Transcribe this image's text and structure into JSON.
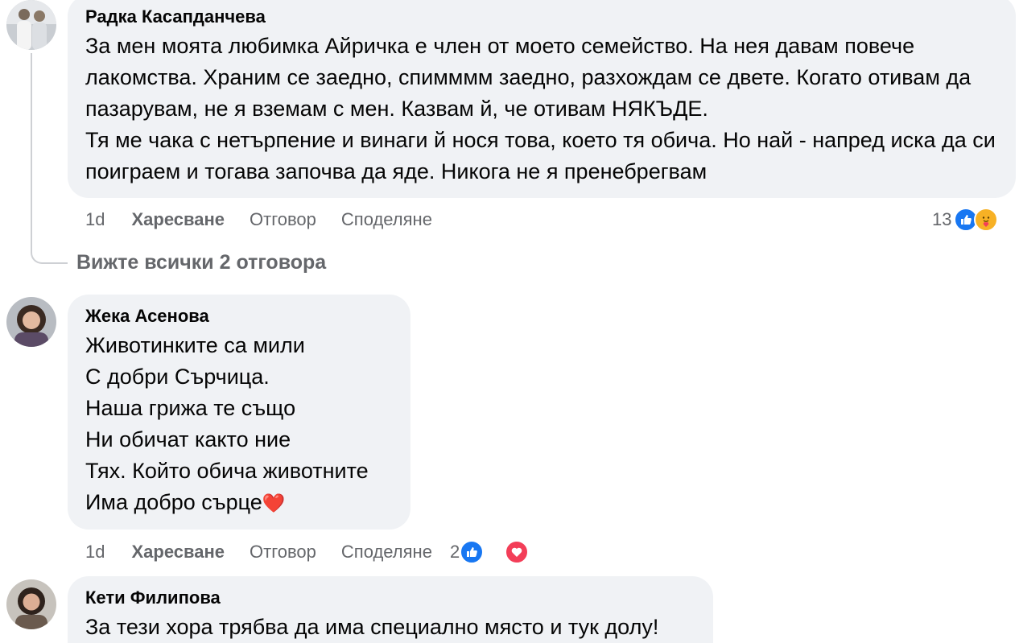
{
  "comments": [
    {
      "author": "Радка Касапданчева",
      "text": "За мен моята любимка Айричка е член от моето семейство. На нея давам повече лакомства. Храним се заедно, спимммм заедно, разхождам се двете. Когато отивам да пазарувам, не я вземам с мен. Казвам й, че отивам НЯКЪДЕ.\nТя ме чака с нетърпение и винаги й нося това, което тя обича. Но най - напред иска да си поиграем и тогава започва да яде. Никога не я пренебрегвам",
      "time": "1d",
      "like_label": "Харесване",
      "reply_label": "Отговор",
      "share_label": "Споделяне",
      "reaction_count": "13",
      "reactions": [
        "like-icon",
        "care-icon"
      ]
    },
    {
      "author": "Жека Асенова",
      "text": "Животинките са мили\nС добри Сърчица.\nНаша грижа те също\nНи обичат както ние\nТях. Който обича животните\nИма добро сърце",
      "text_emoji": "❤️",
      "time": "1d",
      "like_label": "Харесване",
      "reply_label": "Отговор",
      "share_label": "Споделяне",
      "reaction_count": "2",
      "reactions": [
        "like-icon",
        "love-icon"
      ]
    },
    {
      "author": "Кети Филипова",
      "text": "За тези хора трябва да има специално място и тук долу!"
    }
  ],
  "view_replies_label": "Вижте всички 2 отговора",
  "colors": {
    "bubble": "#f0f2f5",
    "meta_text": "#65676b",
    "like_blue": "#1877f2",
    "love_red": "#f33e58",
    "care_yellow": "#f7b125"
  }
}
